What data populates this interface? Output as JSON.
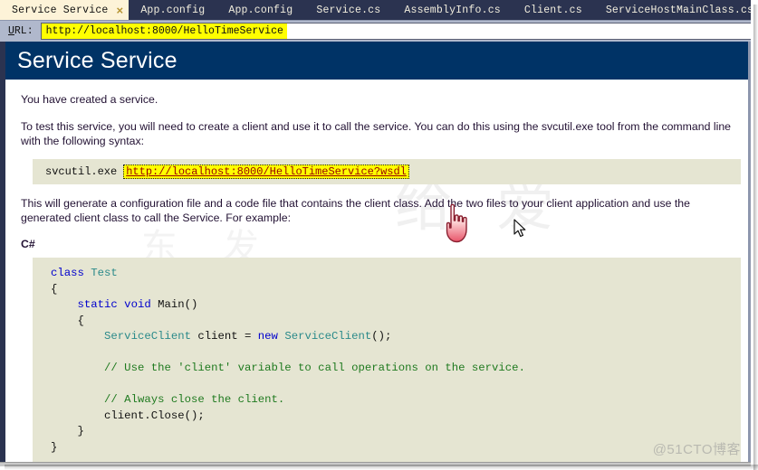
{
  "tabs": [
    {
      "label": "Service Service",
      "active": true,
      "close_icon": "×"
    },
    {
      "label": "App.config",
      "active": false
    },
    {
      "label": "App.config",
      "active": false
    },
    {
      "label": "Service.cs",
      "active": false
    },
    {
      "label": "AssemblyInfo.cs",
      "active": false
    },
    {
      "label": "Client.cs",
      "active": false
    },
    {
      "label": "ServiceHostMainClass.cs",
      "active": false
    }
  ],
  "urlbar": {
    "label_accel": "U",
    "label_rest": "RL:",
    "value": "http://localhost:8000/HelloTimeService"
  },
  "page": {
    "title": "Service Service",
    "paragraph1": "You have created a service.",
    "paragraph2": "To test this service, you will need to create a client and use it to call the service. You can do this using the svcutil.exe tool from the command line with the following syntax:",
    "svcutil": {
      "command": "svcutil.exe",
      "link": "http://localhost:8000/HelloTimeService?wsdl"
    },
    "paragraph3": "This will generate a configuration file and a code file that contains the client class. Add the two files to your client application and use the generated client class to call the Service. For example:",
    "language_label": "C#",
    "code_lines": [
      [
        {
          "t": "class ",
          "c": "kw"
        },
        {
          "t": "Test",
          "c": "type"
        }
      ],
      [
        {
          "t": "{",
          "c": "pl"
        }
      ],
      [
        {
          "t": "    ",
          "c": "pl"
        },
        {
          "t": "static void ",
          "c": "kw"
        },
        {
          "t": "Main()",
          "c": "pl"
        }
      ],
      [
        {
          "t": "    {",
          "c": "pl"
        }
      ],
      [
        {
          "t": "        ",
          "c": "pl"
        },
        {
          "t": "ServiceClient",
          "c": "type"
        },
        {
          "t": " client = ",
          "c": "pl"
        },
        {
          "t": "new ",
          "c": "kw"
        },
        {
          "t": "ServiceClient",
          "c": "type"
        },
        {
          "t": "();",
          "c": "pl"
        }
      ],
      [
        {
          "t": "",
          "c": "pl"
        }
      ],
      [
        {
          "t": "        ",
          "c": "pl"
        },
        {
          "t": "// Use the 'client' variable to call operations on the service.",
          "c": "cmt"
        }
      ],
      [
        {
          "t": "",
          "c": "pl"
        }
      ],
      [
        {
          "t": "        ",
          "c": "pl"
        },
        {
          "t": "// Always close the client.",
          "c": "cmt"
        }
      ],
      [
        {
          "t": "        client.Close();",
          "c": "pl"
        }
      ],
      [
        {
          "t": "    }",
          "c": "pl"
        }
      ],
      [
        {
          "t": "}",
          "c": "pl"
        }
      ]
    ]
  },
  "watermarks": {
    "big": "给 爱",
    "mid": "东 发",
    "corner": "@51CTO博客"
  },
  "colors": {
    "tabbar_bg": "#2b3350",
    "active_tab_bg": "#fdf3d8",
    "urlbar_bg": "#b0b8cc",
    "url_highlight": "#ffff00",
    "header_navy": "#003366",
    "code_bg": "#e5e5d2",
    "link_red": "#990000",
    "keyword_blue": "#0000cd",
    "type_teal": "#2b8a8a",
    "comment_green": "#1f7a1f"
  }
}
